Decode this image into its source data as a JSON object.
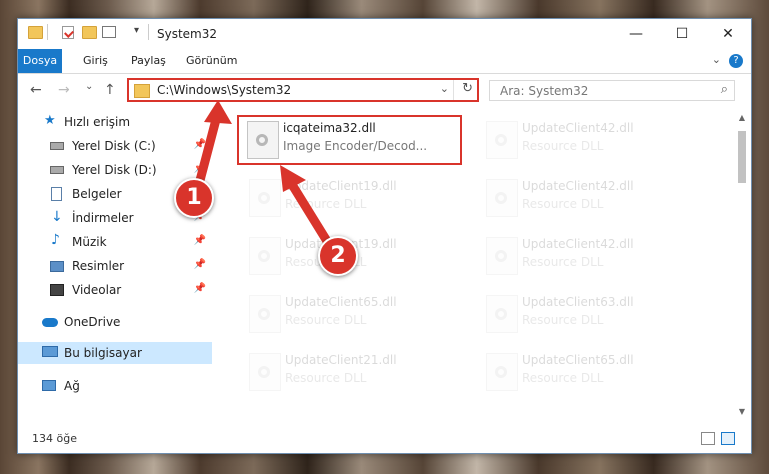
{
  "window": {
    "title": "System32",
    "controls": {
      "minimize": "—",
      "maximize": "☐",
      "close": "✕"
    }
  },
  "ribbon": {
    "tabs": [
      "Dosya",
      "Giriş",
      "Paylaş",
      "Görünüm"
    ],
    "help": "?",
    "expand": "⌄"
  },
  "address": {
    "path": "C:\\Windows\\System32",
    "dropdown": "⌄",
    "refresh": "↻",
    "search_placeholder": "Ara: System32",
    "search_icon": "⌕"
  },
  "navigation": {
    "back": "←",
    "forward": "→",
    "recent": "⌄",
    "up": "↑"
  },
  "sidebar": {
    "items": [
      {
        "label": "Hızlı erişim",
        "icon": "star-icon",
        "pinned": false
      },
      {
        "label": "Yerel Disk (C:)",
        "icon": "drive-icon",
        "pinned": true
      },
      {
        "label": "Yerel Disk (D:)",
        "icon": "drive-icon",
        "pinned": true
      },
      {
        "label": "Belgeler",
        "icon": "documents-icon",
        "pinned": true
      },
      {
        "label": "İndirmeler",
        "icon": "downloads-icon",
        "pinned": true
      },
      {
        "label": "Müzik",
        "icon": "music-icon",
        "pinned": true
      },
      {
        "label": "Resimler",
        "icon": "pictures-icon",
        "pinned": true
      },
      {
        "label": "Videolar",
        "icon": "videos-icon",
        "pinned": true
      },
      {
        "label": "OneDrive",
        "icon": "cloud-icon",
        "pinned": false
      },
      {
        "label": "Bu bilgisayar",
        "icon": "computer-icon",
        "pinned": false,
        "selected": true
      },
      {
        "label": "Ağ",
        "icon": "network-icon",
        "pinned": false
      }
    ],
    "pin_glyph": "📌"
  },
  "files": [
    {
      "name": "icqateima32.dll",
      "desc": "Image Encoder/Decod...",
      "highlighted": true
    },
    {
      "name": "UpdateClient42.dll",
      "desc": "Resource DLL"
    },
    {
      "name": "UpdateClient19.dll",
      "desc": "Resource DLL"
    },
    {
      "name": "UpdateClient42.dll",
      "desc": "Resource DLL"
    },
    {
      "name": "UpdateClient19.dll",
      "desc": "Resource DLL"
    },
    {
      "name": "UpdateClient42.dll",
      "desc": "Resource DLL"
    },
    {
      "name": "UpdateClient65.dll",
      "desc": "Resource DLL"
    },
    {
      "name": "UpdateClient63.dll",
      "desc": "Resource DLL"
    },
    {
      "name": "UpdateClient21.dll",
      "desc": "Resource DLL"
    },
    {
      "name": "UpdateClient65.dll",
      "desc": "Resource DLL"
    }
  ],
  "status": {
    "count": "134 öğe"
  },
  "callouts": [
    "1",
    "2"
  ],
  "colors": {
    "accent": "#1979ca",
    "highlight": "#d9342b",
    "selected": "#cce8ff"
  }
}
